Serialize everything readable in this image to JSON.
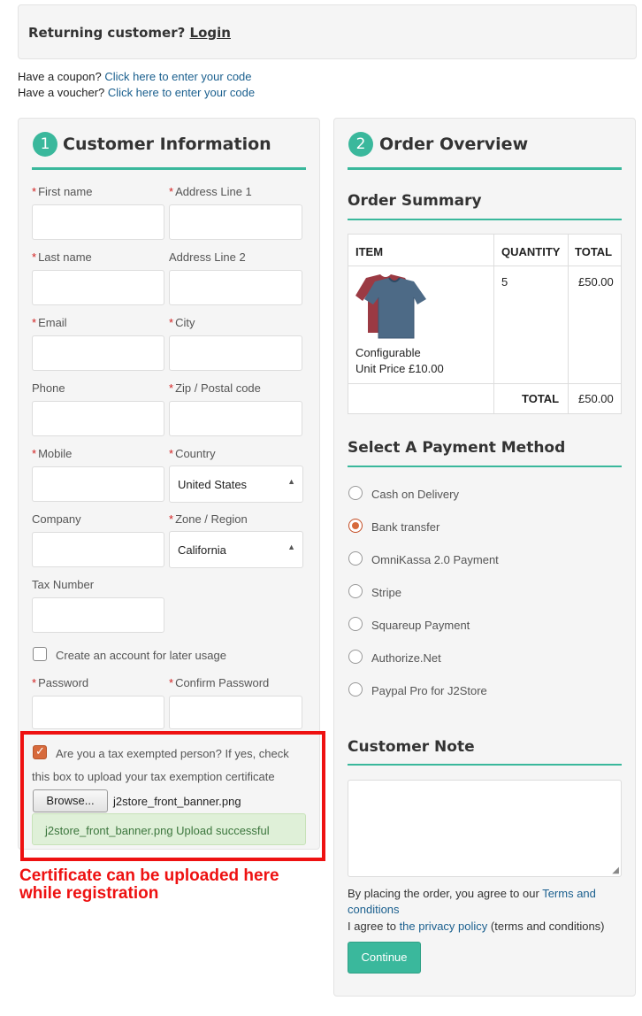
{
  "returning": {
    "text": "Returning customer?",
    "login": "Login"
  },
  "coupon": {
    "text": "Have a coupon?",
    "link": "Click here to enter your code"
  },
  "voucher": {
    "text": "Have a voucher?",
    "link": "Click here to enter your code"
  },
  "customer": {
    "step": "1",
    "title": "Customer Information",
    "fields": {
      "first_name": "First name",
      "address1": "Address Line 1",
      "last_name": "Last name",
      "address2": "Address Line 2",
      "email": "Email",
      "city": "City",
      "phone": "Phone",
      "zip": "Zip / Postal code",
      "mobile": "Mobile",
      "country": "Country",
      "company": "Company",
      "zone": "Zone / Region",
      "tax_number": "Tax Number",
      "password": "Password",
      "confirm_password": "Confirm Password"
    },
    "country_value": "United States",
    "zone_value": "California",
    "create_account": "Create an account for later usage",
    "tax_exempt_line1": "Are you a tax exempted person? If yes, check",
    "tax_exempt_line2": "this box to upload your tax exemption certificate",
    "browse": "Browse...",
    "file_name": "j2store_front_banner.png",
    "upload_msg": "j2store_front_banner.png Upload successful"
  },
  "annotation": {
    "line1": "Certificate can be uploaded here",
    "line2": "while registration"
  },
  "order": {
    "step": "2",
    "title": "Order Overview",
    "summary_title": "Order Summary",
    "headers": {
      "item": "ITEM",
      "quantity": "QUANTITY",
      "total": "TOTAL"
    },
    "item_name": "Configurable",
    "unit_price": "Unit Price £10.00",
    "quantity": "5",
    "line_total": "£50.00",
    "total_label": "TOTAL",
    "grand_total": "£50.00",
    "payment_title": "Select A Payment Method",
    "payment_methods": [
      "Cash on Delivery",
      "Bank transfer",
      "OmniKassa 2.0 Payment",
      "Stripe",
      "Squareup Payment",
      "Authorize.Net",
      "Paypal Pro for J2Store"
    ],
    "selected_payment": "Bank transfer",
    "note_title": "Customer Note",
    "agree_prefix": "By placing the order, you agree to our",
    "terms_link_1": "Terms and",
    "terms_link_2": "conditions",
    "agree2_prefix": "I agree to",
    "privacy_link": "the privacy policy",
    "agree2_suffix": "(terms and conditions)",
    "continue": "Continue"
  },
  "colors": {
    "accent": "#3ab89c",
    "link": "#1a5f8e",
    "required": "#d21f1f",
    "annotation": "#ee1111",
    "radio_checked": "#d76a3c"
  }
}
